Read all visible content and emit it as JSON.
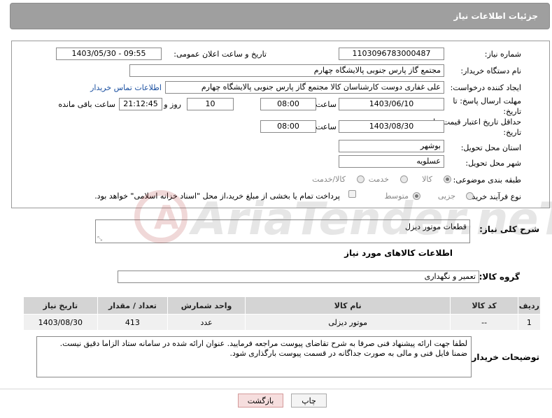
{
  "header": {
    "title": "جزئیات اطلاعات نیاز"
  },
  "form": {
    "need_number_label": "شماره نیاز:",
    "need_number": "1103096783000487",
    "announce_label": "تاریخ و ساعت اعلان عمومی:",
    "announce_value": "1403/05/30 - 09:55",
    "buyer_org_label": "نام دستگاه خریدار:",
    "buyer_org": "مجتمع گاز پارس جنوبی  پالایشگاه چهارم",
    "creator_label": "ایجاد کننده درخواست:",
    "creator": "علی غفاری دوست کارشناسان کالا مجتمع گاز پارس جنوبی  پالایشگاه چهارم",
    "buyer_contact_link": "اطلاعات تماس خریدار",
    "deadline_label": "مهلت ارسال پاسخ: تا تاریخ:",
    "deadline_date": "1403/06/10",
    "time_label": "ساعت",
    "deadline_time": "08:00",
    "days_value": "10",
    "days_label": "روز و",
    "remaining_time": "21:12:45",
    "remaining_label": "ساعت باقی مانده",
    "validity_label": "حداقل تاریخ اعتبار قیمت: تا تاریخ:",
    "validity_date": "1403/08/30",
    "validity_time": "08:00",
    "province_label": "استان محل تحویل:",
    "province": "بوشهر",
    "city_label": "شهر محل تحویل:",
    "city": "عسلویه",
    "category_label": "طبقه بندی موضوعی:",
    "category_options": [
      "کالا",
      "خدمت",
      "کالا/خدمت"
    ],
    "process_label": "نوع فرآیند خرید :",
    "process_options": [
      "جزیی",
      "متوسط"
    ],
    "payment_note": "پرداخت تمام یا بخشی از مبلغ خرید،از محل \"اسناد خزانه اسلامی\" خواهد بود.",
    "description_label": "شرح کلی نیاز:",
    "description": "قطعات موتور دیزل"
  },
  "goods": {
    "section_title": "اطلاعات کالاهای مورد نیاز",
    "group_label": "گروه کالا:",
    "group_value": "تعمیر و نگهداری",
    "columns": [
      "ردیف",
      "کد کالا",
      "نام کالا",
      "واحد شمارش",
      "تعداد / مقدار",
      "تاریخ نیاز"
    ],
    "rows": [
      [
        "1",
        "--",
        "موتور دیزلی",
        "عدد",
        "413",
        "1403/08/30"
      ]
    ]
  },
  "buyer_notes": {
    "label": "توضیحات خریدار:",
    "line1": "لطفا جهت ارائه پیشنهاد فنی صرفا به شرح تقاضای پیوست مراجعه فرمایید. عنوان ارائه شده در سامانه ستاد الزاما دقیق نیست.",
    "line2": "ضمنا فایل فنی و مالی به صورت جداگانه در قسمت پیوست بارگذاری شود."
  },
  "buttons": {
    "print": "چاپ",
    "back": "بازگشت"
  },
  "watermark": {
    "text": "AriaTender.neT"
  },
  "colors": {
    "header_bg": "#9f9f9f",
    "link": "#1a4fa0",
    "back_button_bg": "#f6dede",
    "back_button_border": "#d49a9a"
  }
}
